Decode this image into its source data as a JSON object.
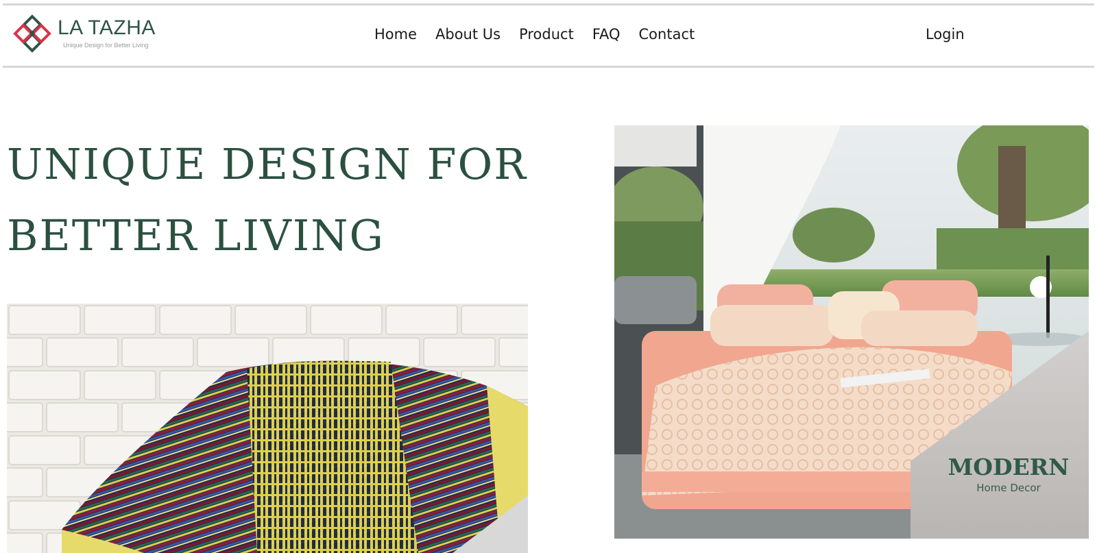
{
  "brand": {
    "name": "LA TAZHA",
    "tagline": "Unique Design for Better Living",
    "logo_icon": "knot-logo-icon"
  },
  "nav": {
    "items": [
      {
        "label": "Home"
      },
      {
        "label": "About Us"
      },
      {
        "label": "Product"
      },
      {
        "label": "FAQ"
      },
      {
        "label": "Contact"
      }
    ],
    "login_label": "Login"
  },
  "hero": {
    "title_line1": "UNIQUE DESIGN FOR",
    "title_line2": "BETTER LIVING"
  },
  "promo": {
    "title": "MODERN",
    "subtitle": "Home Decor"
  },
  "colors": {
    "brand_green": "#2c5040",
    "logo_red": "#d8334a",
    "divider": "#d6d6d6"
  }
}
